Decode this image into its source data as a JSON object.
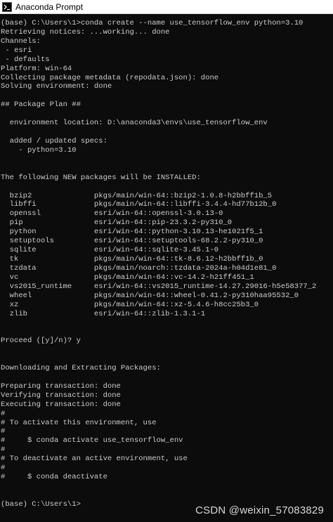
{
  "window": {
    "title": "Anaconda Prompt",
    "icon": "terminal-prompt-icon"
  },
  "console": {
    "lines": [
      "(base) C:\\Users\\1>conda create --name use_tensorflow_env python=3.10",
      "Retrieving notices: ...working... done",
      "Channels:",
      " - esri",
      " - defaults",
      "Platform: win-64",
      "Collecting package metadata (repodata.json): done",
      "Solving environment: done",
      "",
      "## Package Plan ##",
      "",
      "  environment location: D:\\anaconda3\\envs\\use_tensorflow_env",
      "",
      "  added / updated specs:",
      "    - python=3.10",
      "",
      "",
      "The following NEW packages will be INSTALLED:",
      "",
      "  bzip2              pkgs/main/win-64::bzip2-1.0.8-h2bbff1b_5",
      "  libffi             pkgs/main/win-64::libffi-3.4.4-hd77b12b_0",
      "  openssl            esri/win-64::openssl-3.0.13-0",
      "  pip                esri/win-64::pip-23.3.2-py310_0",
      "  python             esri/win-64::python-3.10.13-he1021f5_1",
      "  setuptools         esri/win-64::setuptools-68.2.2-py310_0",
      "  sqlite             esri/win-64::sqlite-3.45.1-0",
      "  tk                 pkgs/main/win-64::tk-8.6.12-h2bbff1b_0",
      "  tzdata             pkgs/main/noarch::tzdata-2024a-h04d1e81_0",
      "  vc                 pkgs/main/win-64::vc-14.2-h21ff451_1",
      "  vs2015_runtime     esri/win-64::vs2015_runtime-14.27.29016-h5e58377_2",
      "  wheel              pkgs/main/win-64::wheel-0.41.2-py310haa95532_0",
      "  xz                 pkgs/main/win-64::xz-5.4.6-h8cc25b3_0",
      "  zlib               esri/win-64::zlib-1.3.1-1",
      "",
      "",
      "Proceed ([y]/n)? y",
      "",
      "",
      "Downloading and Extracting Packages:",
      "",
      "Preparing transaction: done",
      "Verifying transaction: done",
      "Executing transaction: done",
      "#",
      "# To activate this environment, use",
      "#",
      "#     $ conda activate use_tensorflow_env",
      "#",
      "# To deactivate an active environment, use",
      "#",
      "#     $ conda deactivate",
      "",
      "",
      "(base) C:\\Users\\1>"
    ]
  },
  "watermark": {
    "text": "CSDN @weixin_57083829"
  },
  "colors": {
    "background": "#0c0c0c",
    "text": "#cccccc",
    "titlebar": "#ffffff"
  }
}
